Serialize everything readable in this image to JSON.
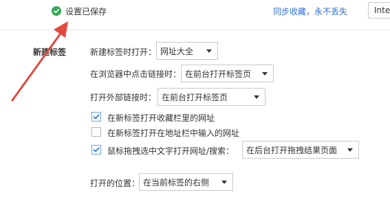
{
  "header": {
    "saved_text": "设置已保存",
    "sync_link": "同步收藏，永不丢失",
    "search_value": "Inte"
  },
  "section": {
    "title": "新建标签",
    "new_tab_open_label": "新建标签时打开：",
    "new_tab_open_value": "网址大全",
    "click_link_label": "在浏览器中点击链接时：",
    "click_link_value": "在前台打开标签页",
    "external_link_label": "打开外部链接时：",
    "external_link_value": "在前台打开标签页",
    "options": [
      {
        "label": "在新标签打开收藏栏里的网址",
        "checked": true
      },
      {
        "label": "在新标签打开在地址栏中输入的网址",
        "checked": false
      },
      {
        "label": "鼠标拖拽选中文字打开网址/搜索：",
        "checked": true
      }
    ],
    "drag_value": "在后台打开拖拽结果页面",
    "position_label": "打开的位置：",
    "position_value": "在当前标签的右侧"
  },
  "colors": {
    "check_green": "#34a853",
    "link_blue": "#2f6fd6",
    "checkbox_blue": "#2b7de9",
    "annotation_red": "#e04a3f"
  }
}
